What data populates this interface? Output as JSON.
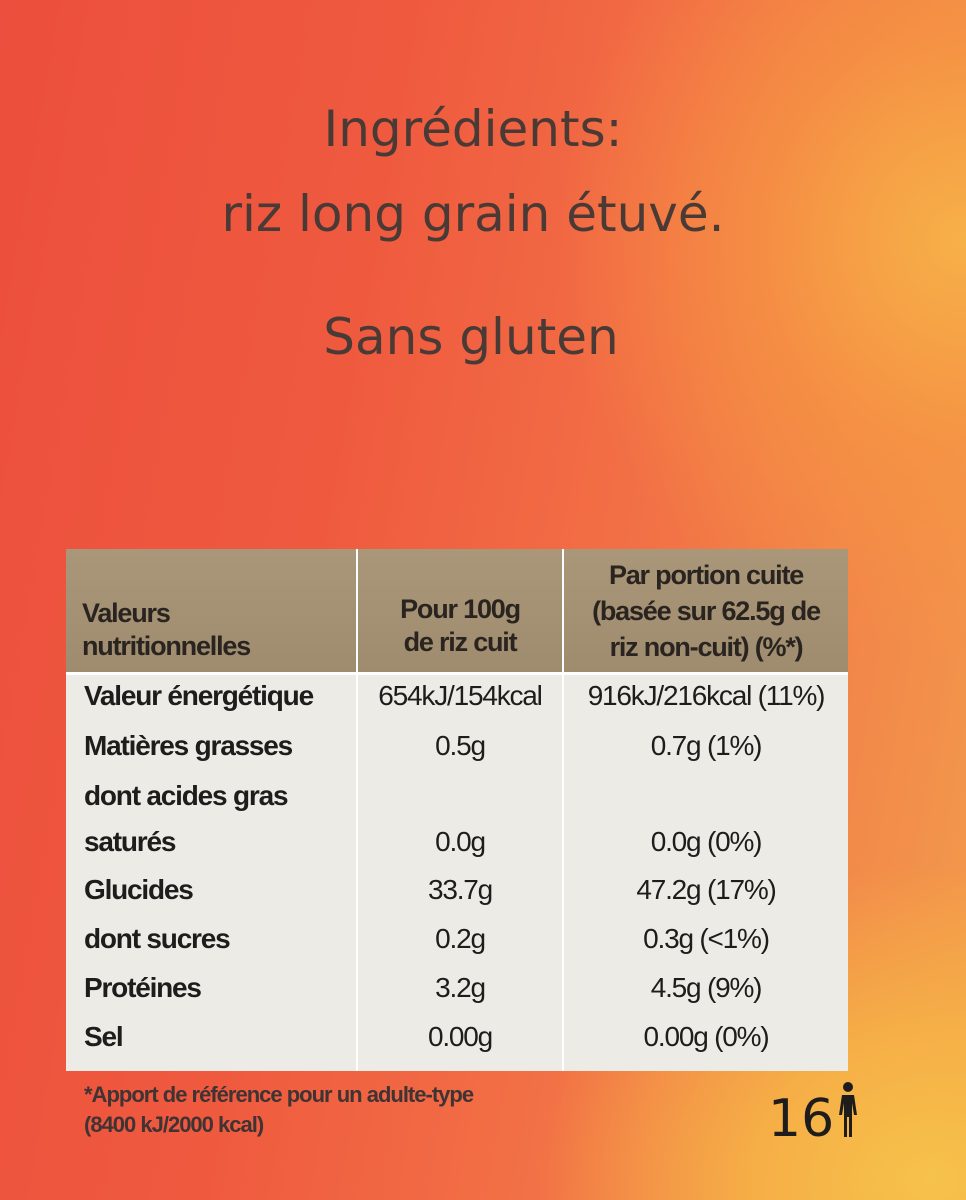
{
  "ingredients": {
    "title": "Ingrédients:",
    "text": "riz long grain étuvé.",
    "claim": "Sans gluten"
  },
  "nutrition_table": {
    "header": {
      "label_line1": "Valeurs",
      "label_line2": "nutritionnelles",
      "col1_line1": "Pour 100g",
      "col1_line2": "de riz cuit",
      "col2_line1": "Par portion cuite",
      "col2_line2": "(basée sur 62.5g de",
      "col2_line3": "riz non-cuit) (%*)"
    },
    "rows": [
      {
        "label": "Valeur énergétique",
        "per100": "654kJ/154kcal",
        "perPortion": "916kJ/216kcal (11%)"
      },
      {
        "label": "Matières grasses",
        "per100": "0.5g",
        "perPortion": "0.7g (1%)"
      },
      {
        "label": "dont acides gras",
        "per100": "",
        "perPortion": ""
      },
      {
        "label": "saturés",
        "per100": "0.0g",
        "perPortion": "0.0g (0%)"
      },
      {
        "label": "Glucides",
        "per100": "33.7g",
        "perPortion": "47.2g (17%)"
      },
      {
        "label": "dont sucres",
        "per100": "0.2g",
        "perPortion": "0.3g (<1%)"
      },
      {
        "label": "Protéines",
        "per100": "3.2g",
        "perPortion": "4.5g (9%)"
      },
      {
        "label": "Sel",
        "per100": "0.00g",
        "perPortion": "0.00g (0%)"
      }
    ]
  },
  "footnote": {
    "line1": "*Apport de référence pour un adulte-type",
    "line2": "(8400 kJ/2000 kcal)"
  },
  "portions": {
    "count": "16",
    "icon": "person-icon"
  }
}
